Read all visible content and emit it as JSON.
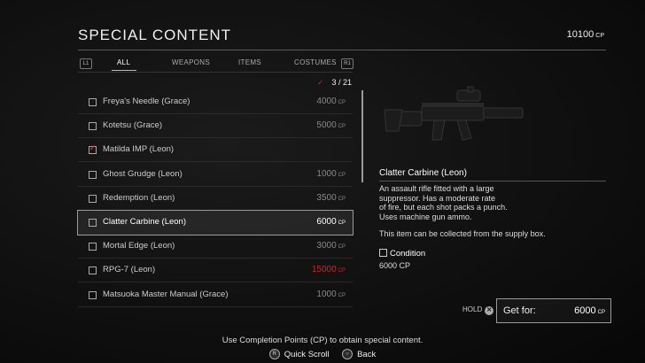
{
  "header": {
    "title": "SPECIAL CONTENT",
    "cp_total": "10100",
    "cp_unit": "CP"
  },
  "tabs": {
    "left_button": "L1",
    "right_button": "R1",
    "items": [
      "ALL",
      "WEAPONS",
      "ITEMS",
      "COSTUMES"
    ],
    "active": "ALL"
  },
  "counter": {
    "check": "✓",
    "text": "3 / 21"
  },
  "list": {
    "items": [
      {
        "name": "Freya's Needle (Grace)",
        "price": "4000",
        "unit": "CP",
        "owned": false
      },
      {
        "name": "Kotetsu (Grace)",
        "price": "5000",
        "unit": "CP",
        "owned": false
      },
      {
        "name": "Matilda IMP (Leon)",
        "price": "",
        "unit": "",
        "owned": true
      },
      {
        "name": "Ghost Grudge (Leon)",
        "price": "1000",
        "unit": "CP",
        "owned": false
      },
      {
        "name": "Redemption (Leon)",
        "price": "3500",
        "unit": "CP",
        "owned": false
      },
      {
        "name": "Clatter Carbine (Leon)",
        "price": "6000",
        "unit": "CP",
        "owned": false,
        "selected": true
      },
      {
        "name": "Mortal Edge (Leon)",
        "price": "3000",
        "unit": "CP",
        "owned": false
      },
      {
        "name": "RPG-7 (Leon)",
        "price": "15000",
        "unit": "CP",
        "owned": false,
        "unaffordable": true
      },
      {
        "name": "Matsuoka Master Manual (Grace)",
        "price": "1000",
        "unit": "CP",
        "owned": false
      }
    ]
  },
  "detail": {
    "name": "Clatter Carbine (Leon)",
    "description": "An assault rifle fitted with a large\nsuppressor. Has a moderate rate\nof fire, but each shot packs a punch.\nUses machine gun ammo.",
    "collect_note": "This item can be collected from the supply box.",
    "condition_label": "Condition",
    "condition_cp": "6000 CP"
  },
  "purchase": {
    "hold_label": "HOLD",
    "hold_button": "✕",
    "get_for_label": "Get for:",
    "price": "6000",
    "unit": "CP"
  },
  "footer": {
    "note": "Use Completion Points (CP) to obtain special content.",
    "scroll_icon": "R",
    "scroll_label": "Quick Scroll",
    "back_icon": "○",
    "back_label": "Back"
  },
  "colors": {
    "accent_red": "#c0282f"
  }
}
